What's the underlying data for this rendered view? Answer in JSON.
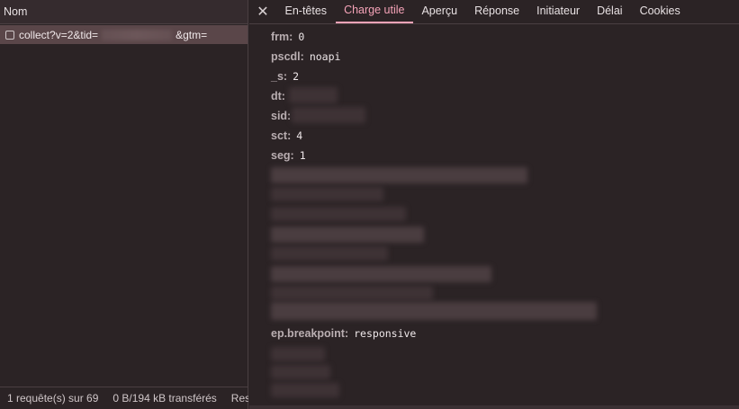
{
  "left": {
    "header": "Nom",
    "request": {
      "prefix": "collect?v=2&tid=",
      "suffix": "&gtm="
    },
    "status": {
      "count": "1 requête(s) sur 69",
      "transfer": "0 B/194 kB transférés",
      "resources": "Res"
    }
  },
  "tabs": [
    "En-têtes",
    "Charge utile",
    "Aperçu",
    "Réponse",
    "Initiateur",
    "Délai",
    "Cookies"
  ],
  "active_tab": "Charge utile",
  "payload": [
    {
      "key": "frm:",
      "value": "0"
    },
    {
      "key": "pscdl:",
      "value": "noapi"
    },
    {
      "key": "_s:",
      "value": "2"
    },
    {
      "key": "dt:",
      "value": ""
    },
    {
      "key": "sid:",
      "value": ""
    },
    {
      "key": "sct:",
      "value": "4"
    },
    {
      "key": "seg:",
      "value": "1"
    },
    {
      "key": "ep.breakpoint:",
      "value": "responsive"
    }
  ],
  "colors": {
    "accent": "#f5a3b8",
    "background": "#2b2325",
    "selected_row": "#5a4649"
  },
  "icons": {
    "close": "close-icon",
    "checkbox": "checkbox-icon"
  }
}
